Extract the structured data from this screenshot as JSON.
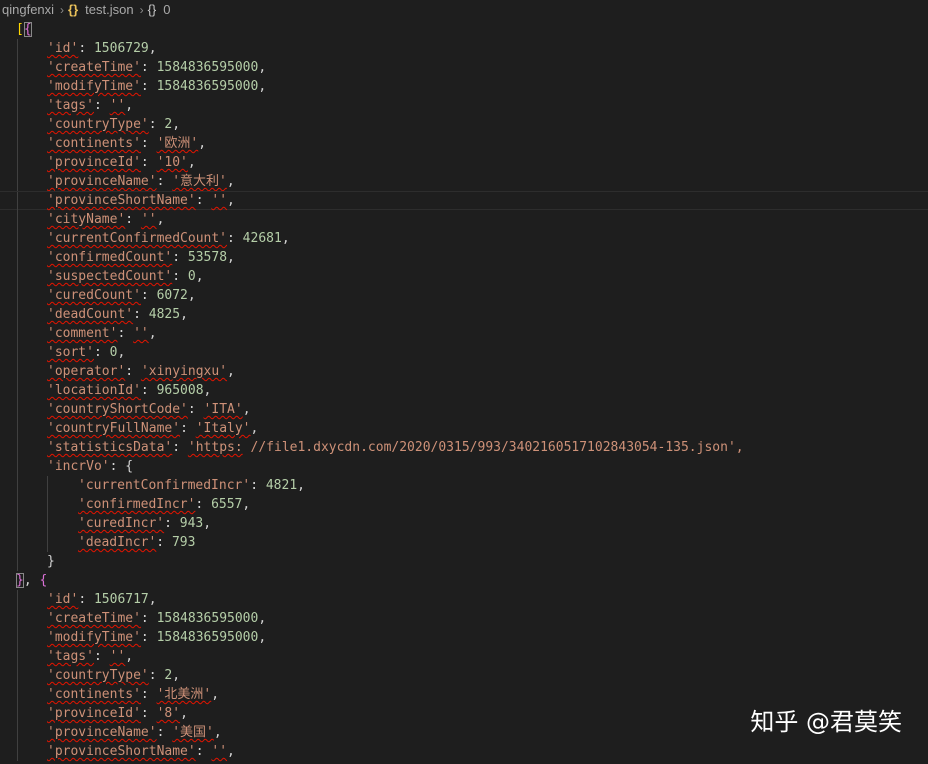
{
  "breadcrumb": {
    "folder": "qingfenxi",
    "file": "test.json",
    "json_icon": "{}",
    "object_icon": "{}",
    "node": "0",
    "separator": "›"
  },
  "editor": {
    "lines": [
      {
        "indent": 0,
        "tokens": [
          {
            "t": "[",
            "c": "bracket"
          },
          {
            "t": "{",
            "c": "brace",
            "match": true
          }
        ]
      },
      {
        "indent": 1,
        "tokens": [
          {
            "t": "'id'",
            "c": "key",
            "sq": true
          },
          {
            "t": ": ",
            "c": "punc"
          },
          {
            "t": "1506729",
            "c": "num"
          },
          {
            "t": ",",
            "c": "punc"
          }
        ]
      },
      {
        "indent": 1,
        "tokens": [
          {
            "t": "'createTime'",
            "c": "key",
            "sq": true
          },
          {
            "t": ": ",
            "c": "punc"
          },
          {
            "t": "1584836595000",
            "c": "num"
          },
          {
            "t": ",",
            "c": "punc"
          }
        ]
      },
      {
        "indent": 1,
        "tokens": [
          {
            "t": "'modifyTime'",
            "c": "key",
            "sq": true
          },
          {
            "t": ": ",
            "c": "punc"
          },
          {
            "t": "1584836595000",
            "c": "num"
          },
          {
            "t": ",",
            "c": "punc"
          }
        ]
      },
      {
        "indent": 1,
        "tokens": [
          {
            "t": "'tags'",
            "c": "key",
            "sq": true
          },
          {
            "t": ": ",
            "c": "punc"
          },
          {
            "t": "''",
            "c": "str",
            "sq": true
          },
          {
            "t": ",",
            "c": "punc"
          }
        ]
      },
      {
        "indent": 1,
        "tokens": [
          {
            "t": "'countryType'",
            "c": "key",
            "sq": true
          },
          {
            "t": ": ",
            "c": "punc"
          },
          {
            "t": "2",
            "c": "num"
          },
          {
            "t": ",",
            "c": "punc"
          }
        ]
      },
      {
        "indent": 1,
        "tokens": [
          {
            "t": "'continents'",
            "c": "key",
            "sq": true
          },
          {
            "t": ": ",
            "c": "punc"
          },
          {
            "t": "'欧洲'",
            "c": "str",
            "sq": true
          },
          {
            "t": ",",
            "c": "punc"
          }
        ]
      },
      {
        "indent": 1,
        "tokens": [
          {
            "t": "'provinceId'",
            "c": "key",
            "sq": true
          },
          {
            "t": ": ",
            "c": "punc"
          },
          {
            "t": "'10'",
            "c": "str",
            "sq": true
          },
          {
            "t": ",",
            "c": "punc"
          }
        ]
      },
      {
        "indent": 1,
        "tokens": [
          {
            "t": "'provinceName'",
            "c": "key",
            "sq": true
          },
          {
            "t": ": ",
            "c": "punc"
          },
          {
            "t": "'意大利'",
            "c": "str",
            "sq": true
          },
          {
            "t": ",",
            "c": "punc"
          }
        ]
      },
      {
        "indent": 1,
        "current": true,
        "tokens": [
          {
            "t": "'provinceShortName'",
            "c": "key",
            "sq": true
          },
          {
            "t": ": ",
            "c": "punc"
          },
          {
            "t": "''",
            "c": "str",
            "sq": true
          },
          {
            "t": ",",
            "c": "punc"
          }
        ]
      },
      {
        "indent": 1,
        "tokens": [
          {
            "t": "'cityName'",
            "c": "key",
            "sq": true
          },
          {
            "t": ": ",
            "c": "punc"
          },
          {
            "t": "''",
            "c": "str",
            "sq": true
          },
          {
            "t": ",",
            "c": "punc"
          }
        ]
      },
      {
        "indent": 1,
        "tokens": [
          {
            "t": "'currentConfirmedCount'",
            "c": "key",
            "sq": true
          },
          {
            "t": ": ",
            "c": "punc"
          },
          {
            "t": "42681",
            "c": "num"
          },
          {
            "t": ",",
            "c": "punc"
          }
        ]
      },
      {
        "indent": 1,
        "tokens": [
          {
            "t": "'confirmedCount'",
            "c": "key",
            "sq": true
          },
          {
            "t": ": ",
            "c": "punc"
          },
          {
            "t": "53578",
            "c": "num"
          },
          {
            "t": ",",
            "c": "punc"
          }
        ]
      },
      {
        "indent": 1,
        "tokens": [
          {
            "t": "'suspectedCount'",
            "c": "key",
            "sq": true
          },
          {
            "t": ": ",
            "c": "punc"
          },
          {
            "t": "0",
            "c": "num"
          },
          {
            "t": ",",
            "c": "punc"
          }
        ]
      },
      {
        "indent": 1,
        "tokens": [
          {
            "t": "'curedCount'",
            "c": "key",
            "sq": true
          },
          {
            "t": ": ",
            "c": "punc"
          },
          {
            "t": "6072",
            "c": "num"
          },
          {
            "t": ",",
            "c": "punc"
          }
        ]
      },
      {
        "indent": 1,
        "tokens": [
          {
            "t": "'deadCount'",
            "c": "key",
            "sq": true
          },
          {
            "t": ": ",
            "c": "punc"
          },
          {
            "t": "4825",
            "c": "num"
          },
          {
            "t": ",",
            "c": "punc"
          }
        ]
      },
      {
        "indent": 1,
        "tokens": [
          {
            "t": "'comment'",
            "c": "key",
            "sq": true
          },
          {
            "t": ": ",
            "c": "punc"
          },
          {
            "t": "''",
            "c": "str",
            "sq": true
          },
          {
            "t": ",",
            "c": "punc"
          }
        ]
      },
      {
        "indent": 1,
        "tokens": [
          {
            "t": "'sort'",
            "c": "key",
            "sq": true
          },
          {
            "t": ": ",
            "c": "punc"
          },
          {
            "t": "0",
            "c": "num"
          },
          {
            "t": ",",
            "c": "punc"
          }
        ]
      },
      {
        "indent": 1,
        "tokens": [
          {
            "t": "'operator'",
            "c": "key",
            "sq": true
          },
          {
            "t": ": ",
            "c": "punc"
          },
          {
            "t": "'xinyingxu'",
            "c": "str",
            "sq": true
          },
          {
            "t": ",",
            "c": "punc"
          }
        ]
      },
      {
        "indent": 1,
        "tokens": [
          {
            "t": "'locationId'",
            "c": "key",
            "sq": true
          },
          {
            "t": ": ",
            "c": "punc"
          },
          {
            "t": "965008",
            "c": "num"
          },
          {
            "t": ",",
            "c": "punc"
          }
        ]
      },
      {
        "indent": 1,
        "tokens": [
          {
            "t": "'countryShortCode'",
            "c": "key",
            "sq": true
          },
          {
            "t": ": ",
            "c": "punc"
          },
          {
            "t": "'ITA'",
            "c": "str",
            "sq": true
          },
          {
            "t": ",",
            "c": "punc"
          }
        ]
      },
      {
        "indent": 1,
        "tokens": [
          {
            "t": "'countryFullName'",
            "c": "key",
            "sq": true
          },
          {
            "t": ": ",
            "c": "punc"
          },
          {
            "t": "'Italy'",
            "c": "str",
            "sq": true
          },
          {
            "t": ",",
            "c": "punc"
          }
        ]
      },
      {
        "indent": 1,
        "tokens": [
          {
            "t": "'statisticsData'",
            "c": "key",
            "sq": true
          },
          {
            "t": ": ",
            "c": "punc"
          },
          {
            "t": "'https:",
            "c": "str",
            "sq": true
          },
          {
            "t": " //file1.dxycdn.com/2020/0315/993/3402160517102843054-135.json',",
            "c": "str"
          }
        ]
      },
      {
        "indent": 1,
        "tokens": [
          {
            "t": "'incrVo'",
            "c": "key"
          },
          {
            "t": ": {",
            "c": "punc"
          }
        ]
      },
      {
        "indent": 2,
        "tokens": [
          {
            "t": "'currentConfirmedIncr'",
            "c": "key"
          },
          {
            "t": ": ",
            "c": "punc"
          },
          {
            "t": "4821",
            "c": "num"
          },
          {
            "t": ",",
            "c": "punc"
          }
        ]
      },
      {
        "indent": 2,
        "tokens": [
          {
            "t": "'confirmedIncr'",
            "c": "key",
            "sq": true
          },
          {
            "t": ": ",
            "c": "punc"
          },
          {
            "t": "6557",
            "c": "num"
          },
          {
            "t": ",",
            "c": "punc"
          }
        ]
      },
      {
        "indent": 2,
        "tokens": [
          {
            "t": "'curedIncr'",
            "c": "key",
            "sq": true
          },
          {
            "t": ": ",
            "c": "punc"
          },
          {
            "t": "943",
            "c": "num"
          },
          {
            "t": ",",
            "c": "punc"
          }
        ]
      },
      {
        "indent": 2,
        "tokens": [
          {
            "t": "'deadIncr'",
            "c": "key",
            "sq": true
          },
          {
            "t": ": ",
            "c": "punc"
          },
          {
            "t": "793",
            "c": "num"
          }
        ]
      },
      {
        "indent": 1,
        "tokens": [
          {
            "t": "}",
            "c": "punc"
          }
        ]
      },
      {
        "indent": 0,
        "tokens": [
          {
            "t": "}",
            "c": "brace",
            "match": true
          },
          {
            "t": ", ",
            "c": "punc"
          },
          {
            "t": "{",
            "c": "brace"
          }
        ]
      },
      {
        "indent": 1,
        "tokens": [
          {
            "t": "'id'",
            "c": "key",
            "sq": true
          },
          {
            "t": ": ",
            "c": "punc"
          },
          {
            "t": "1506717",
            "c": "num"
          },
          {
            "t": ",",
            "c": "punc"
          }
        ]
      },
      {
        "indent": 1,
        "tokens": [
          {
            "t": "'createTime'",
            "c": "key",
            "sq": true
          },
          {
            "t": ": ",
            "c": "punc"
          },
          {
            "t": "1584836595000",
            "c": "num"
          },
          {
            "t": ",",
            "c": "punc"
          }
        ]
      },
      {
        "indent": 1,
        "tokens": [
          {
            "t": "'modifyTime'",
            "c": "key",
            "sq": true
          },
          {
            "t": ": ",
            "c": "punc"
          },
          {
            "t": "1584836595000",
            "c": "num"
          },
          {
            "t": ",",
            "c": "punc"
          }
        ]
      },
      {
        "indent": 1,
        "tokens": [
          {
            "t": "'tags'",
            "c": "key",
            "sq": true
          },
          {
            "t": ": ",
            "c": "punc"
          },
          {
            "t": "''",
            "c": "str",
            "sq": true
          },
          {
            "t": ",",
            "c": "punc"
          }
        ]
      },
      {
        "indent": 1,
        "tokens": [
          {
            "t": "'countryType'",
            "c": "key",
            "sq": true
          },
          {
            "t": ": ",
            "c": "punc"
          },
          {
            "t": "2",
            "c": "num"
          },
          {
            "t": ",",
            "c": "punc"
          }
        ]
      },
      {
        "indent": 1,
        "tokens": [
          {
            "t": "'continents'",
            "c": "key",
            "sq": true
          },
          {
            "t": ": ",
            "c": "punc"
          },
          {
            "t": "'北美洲'",
            "c": "str",
            "sq": true
          },
          {
            "t": ",",
            "c": "punc"
          }
        ]
      },
      {
        "indent": 1,
        "tokens": [
          {
            "t": "'provinceId'",
            "c": "key",
            "sq": true
          },
          {
            "t": ": ",
            "c": "punc"
          },
          {
            "t": "'8'",
            "c": "str",
            "sq": true
          },
          {
            "t": ",",
            "c": "punc"
          }
        ]
      },
      {
        "indent": 1,
        "tokens": [
          {
            "t": "'provinceName'",
            "c": "key",
            "sq": true
          },
          {
            "t": ": ",
            "c": "punc"
          },
          {
            "t": "'美国'",
            "c": "str",
            "sq": true
          },
          {
            "t": ",",
            "c": "punc"
          }
        ]
      },
      {
        "indent": 1,
        "tokens": [
          {
            "t": "'provinceShortName'",
            "c": "key",
            "sq": true
          },
          {
            "t": ": ",
            "c": "punc"
          },
          {
            "t": "''",
            "c": "str",
            "sq": true
          },
          {
            "t": ",",
            "c": "punc"
          }
        ]
      }
    ]
  },
  "watermark": {
    "text": "知乎 @君莫笑"
  },
  "colors": {
    "background": "#1e1e1e",
    "key_string": "#ce9178",
    "number": "#b5cea8",
    "bracket": "#ffd700",
    "brace": "#da70d6",
    "squiggle_error": "#e51400"
  }
}
